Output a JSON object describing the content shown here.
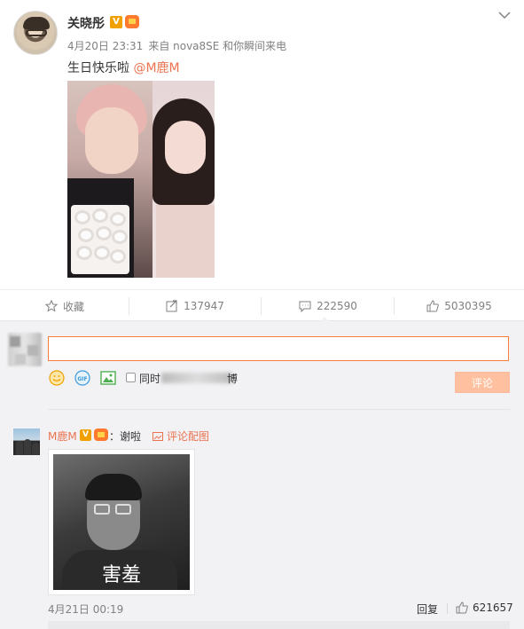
{
  "post": {
    "author": "关晓彤",
    "v_badge": "V",
    "date": "4月20日 23:31",
    "source": "来自 nova8SE 和你瞬间来电",
    "text": "生日快乐啦 ",
    "mention": "@M鹿M"
  },
  "actions": {
    "favorite": "收藏",
    "reposts": "137947",
    "comments": "222590",
    "likes": "5030395"
  },
  "composer": {
    "placeholder": "",
    "sync_prefix": "同时",
    "sync_suffix": "博",
    "submit": "评论"
  },
  "comment": {
    "author": "M鹿M",
    "v_badge": "V",
    "text": "：谢啦",
    "pic_link": "评论配图",
    "image_caption": "害羞",
    "time": "4月21日 00:19",
    "reply": "回复",
    "likes": "621657"
  },
  "colors": {
    "accent": "#eb7350",
    "input_border": "#fa7d3c",
    "submit_bg": "#ffc09f",
    "comment_bg": "#f2f2f5"
  },
  "icons": [
    "chevron-down-icon",
    "star-icon",
    "repost-icon",
    "comment-icon",
    "like-icon",
    "emoji-icon",
    "gif-icon",
    "image-icon",
    "picture-icon",
    "thumb-up-icon"
  ]
}
